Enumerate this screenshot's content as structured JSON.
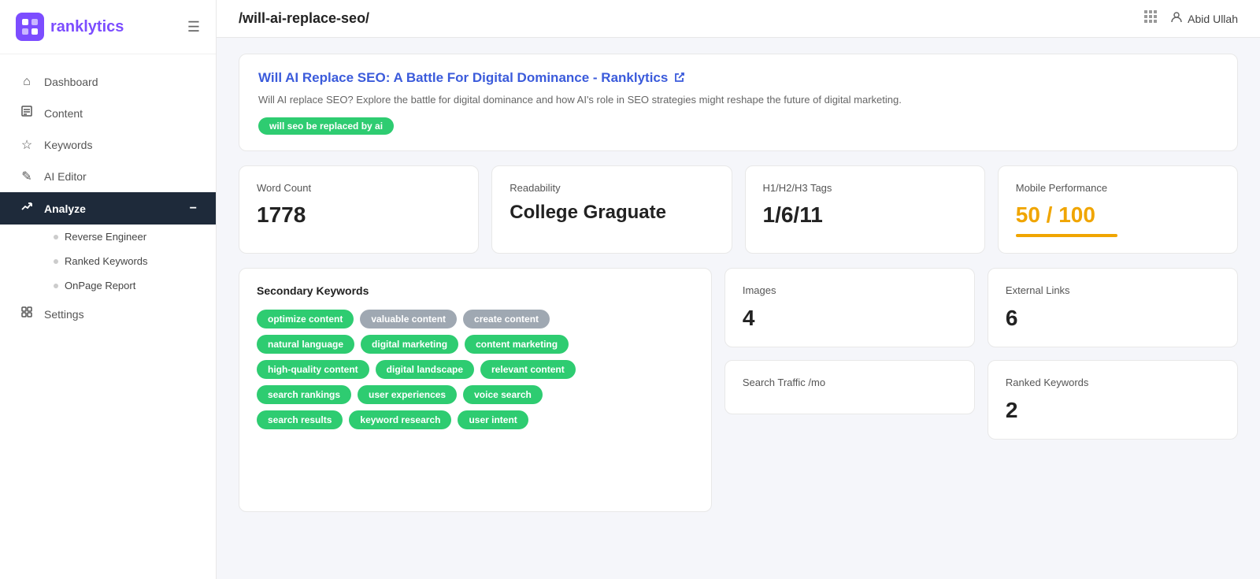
{
  "sidebar": {
    "logo_text": "ranklytics",
    "logo_icon": "R",
    "nav_items": [
      {
        "id": "dashboard",
        "label": "Dashboard",
        "icon": "⌂"
      },
      {
        "id": "content",
        "label": "Content",
        "icon": "☰"
      },
      {
        "id": "keywords",
        "label": "Keywords",
        "icon": "✦"
      },
      {
        "id": "ai-editor",
        "label": "AI Editor",
        "icon": "✎"
      },
      {
        "id": "analyze",
        "label": "Analyze",
        "icon": "↗",
        "active": true
      },
      {
        "id": "settings",
        "label": "Settings",
        "icon": "⊞"
      }
    ],
    "sub_items": [
      {
        "id": "reverse-engineer",
        "label": "Reverse Engineer"
      },
      {
        "id": "ranked-keywords",
        "label": "Ranked Keywords"
      },
      {
        "id": "onpage-report",
        "label": "OnPage Report"
      }
    ]
  },
  "header": {
    "path": "/will-ai-replace-seo/",
    "user": "Abid Ullah"
  },
  "article": {
    "title": "Will AI Replace SEO: A Battle For Digital Dominance - Ranklytics",
    "description": "Will AI replace SEO? Explore the battle for digital dominance and how AI's role in SEO strategies might reshape the future of digital marketing.",
    "tag": "will seo be replaced by ai"
  },
  "stats": {
    "word_count": {
      "label": "Word Count",
      "value": "1778"
    },
    "readability": {
      "label": "Readability",
      "value": "College Graguate"
    },
    "tags": {
      "label": "H1/H2/H3 Tags",
      "value": "1/6/11"
    },
    "mobile": {
      "label": "Mobile Performance",
      "value": "50 / 100",
      "bar_pct": 50
    }
  },
  "secondary_keywords": {
    "title": "Secondary Keywords",
    "rows": [
      [
        {
          "text": "optimize content",
          "color": "green"
        },
        {
          "text": "valuable content",
          "color": "gray"
        },
        {
          "text": "create content",
          "color": "gray"
        }
      ],
      [
        {
          "text": "natural language",
          "color": "green"
        },
        {
          "text": "digital marketing",
          "color": "green"
        },
        {
          "text": "content marketing",
          "color": "green"
        }
      ],
      [
        {
          "text": "high-quality content",
          "color": "green"
        },
        {
          "text": "digital landscape",
          "color": "green"
        },
        {
          "text": "relevant content",
          "color": "green"
        }
      ],
      [
        {
          "text": "search rankings",
          "color": "green"
        },
        {
          "text": "user experiences",
          "color": "green"
        },
        {
          "text": "voice search",
          "color": "green"
        }
      ],
      [
        {
          "text": "search results",
          "color": "green"
        },
        {
          "text": "keyword research",
          "color": "green"
        },
        {
          "text": "user intent",
          "color": "green"
        }
      ]
    ]
  },
  "images": {
    "label": "Images",
    "value": "4"
  },
  "external_links": {
    "label": "External Links",
    "value": "6"
  },
  "search_traffic": {
    "label": "Search Traffic /mo",
    "value": ""
  },
  "ranked_keywords": {
    "label": "Ranked Keywords",
    "value": "2"
  }
}
